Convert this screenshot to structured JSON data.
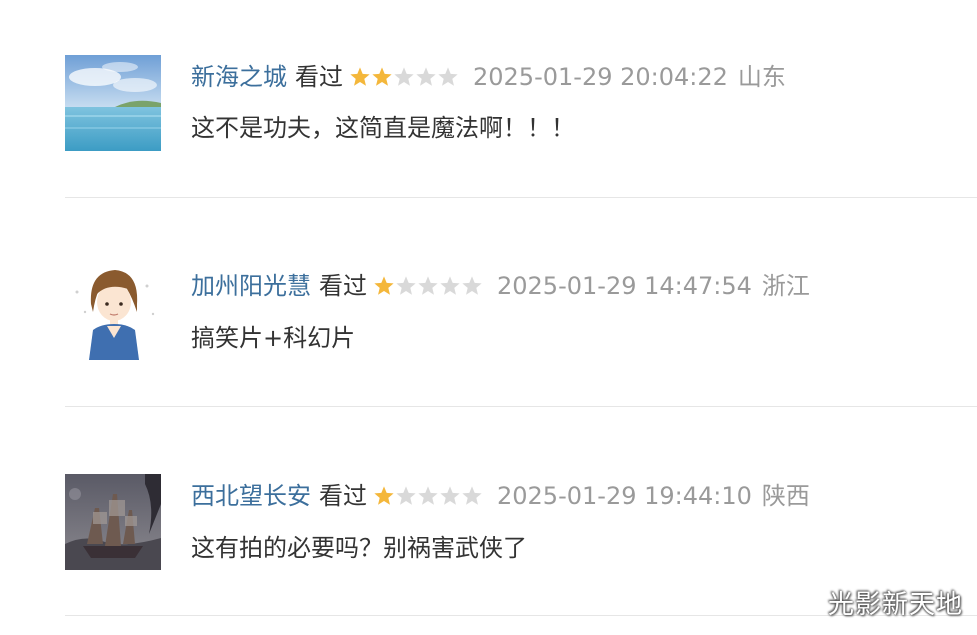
{
  "comments": [
    {
      "username": "新海之城",
      "status": "看过",
      "rating": 2,
      "max_rating": 5,
      "time": "2025-01-29 20:04:22",
      "region": "山东",
      "text": "这不是功夫，这简直是魔法啊！！！",
      "avatar": "sea-landscape-avatar"
    },
    {
      "username": "加州阳光慧",
      "status": "看过",
      "rating": 1,
      "max_rating": 5,
      "time": "2025-01-29 14:47:54",
      "region": "浙江",
      "text": "搞笑片+科幻片",
      "avatar": "cartoon-girl-avatar"
    },
    {
      "username": "西北望长安",
      "status": "看过",
      "rating": 1,
      "max_rating": 5,
      "time": "2025-01-29 19:44:10",
      "region": "陕西",
      "text": "这有拍的必要吗？别祸害武侠了",
      "avatar": "ship-painting-avatar"
    }
  ],
  "colors": {
    "username": "#3c6f9c",
    "star_filled": "#f4b73b",
    "star_empty": "#d9d9d9",
    "meta": "#9a9a9a",
    "text": "#333333"
  },
  "watermark": "光影新天地"
}
